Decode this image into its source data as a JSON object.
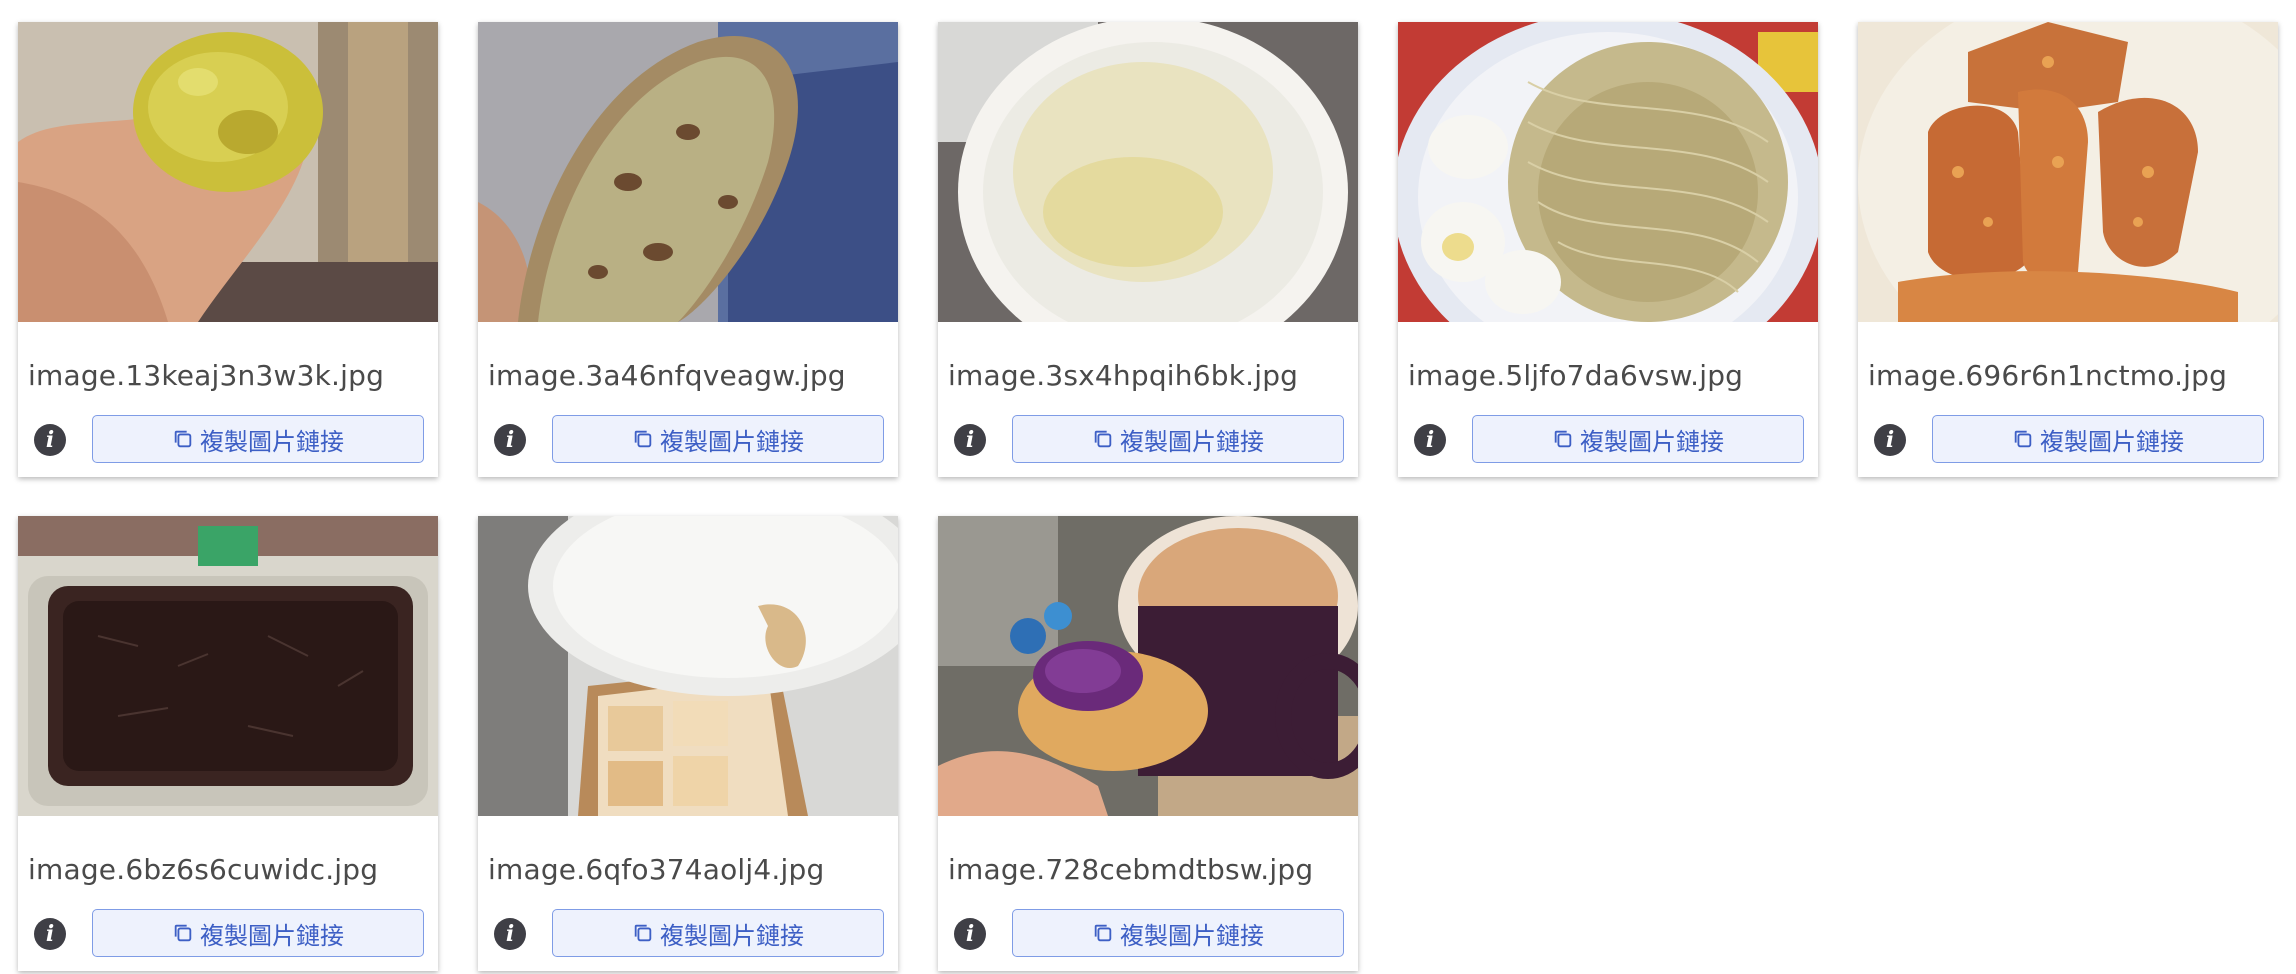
{
  "cards": [
    {
      "filename": "image.13keaj3n3w3k.jpg",
      "copy_label": "複製圖片鏈接",
      "info_icon": "i",
      "photo": "baked-sweet-potato-in-hand"
    },
    {
      "filename": "image.3a46nfqveagw.jpg",
      "copy_label": "複製圖片鏈接",
      "info_icon": "i",
      "photo": "sliced-raisin-bread"
    },
    {
      "filename": "image.3sx4hpqih6bk.jpg",
      "copy_label": "複製圖片鏈接",
      "info_icon": "i",
      "photo": "yogurt-cup"
    },
    {
      "filename": "image.5ljfo7da6vsw.jpg",
      "copy_label": "複製圖片鏈接",
      "info_icon": "i",
      "photo": "noodles-with-boiled-eggs"
    },
    {
      "filename": "image.696r6n1nctmo.jpg",
      "copy_label": "複製圖片鏈接",
      "info_icon": "i",
      "photo": "fried-chicken-pieces"
    },
    {
      "filename": "image.6bz6s6cuwidc.jpg",
      "copy_label": "複製圖片鏈接",
      "info_icon": "i",
      "photo": "grass-jelly-container"
    },
    {
      "filename": "image.6qfo374aolj4.jpg",
      "copy_label": "複製圖片鏈接",
      "info_icon": "i",
      "photo": "tofu-and-glass-bowl"
    },
    {
      "filename": "image.728cebmdtbsw.jpg",
      "copy_label": "複製圖片鏈接",
      "info_icon": "i",
      "photo": "taro-pastry-and-mug"
    }
  ],
  "colors": {
    "button_bg": "#eef2fd",
    "button_border": "#7f9ce6",
    "button_text": "#3d5fc5",
    "info_icon_bg": "#3f3f46",
    "filename_text": "#4a4a4a"
  },
  "icons": {
    "copy": "copy-icon",
    "info": "info-icon"
  }
}
